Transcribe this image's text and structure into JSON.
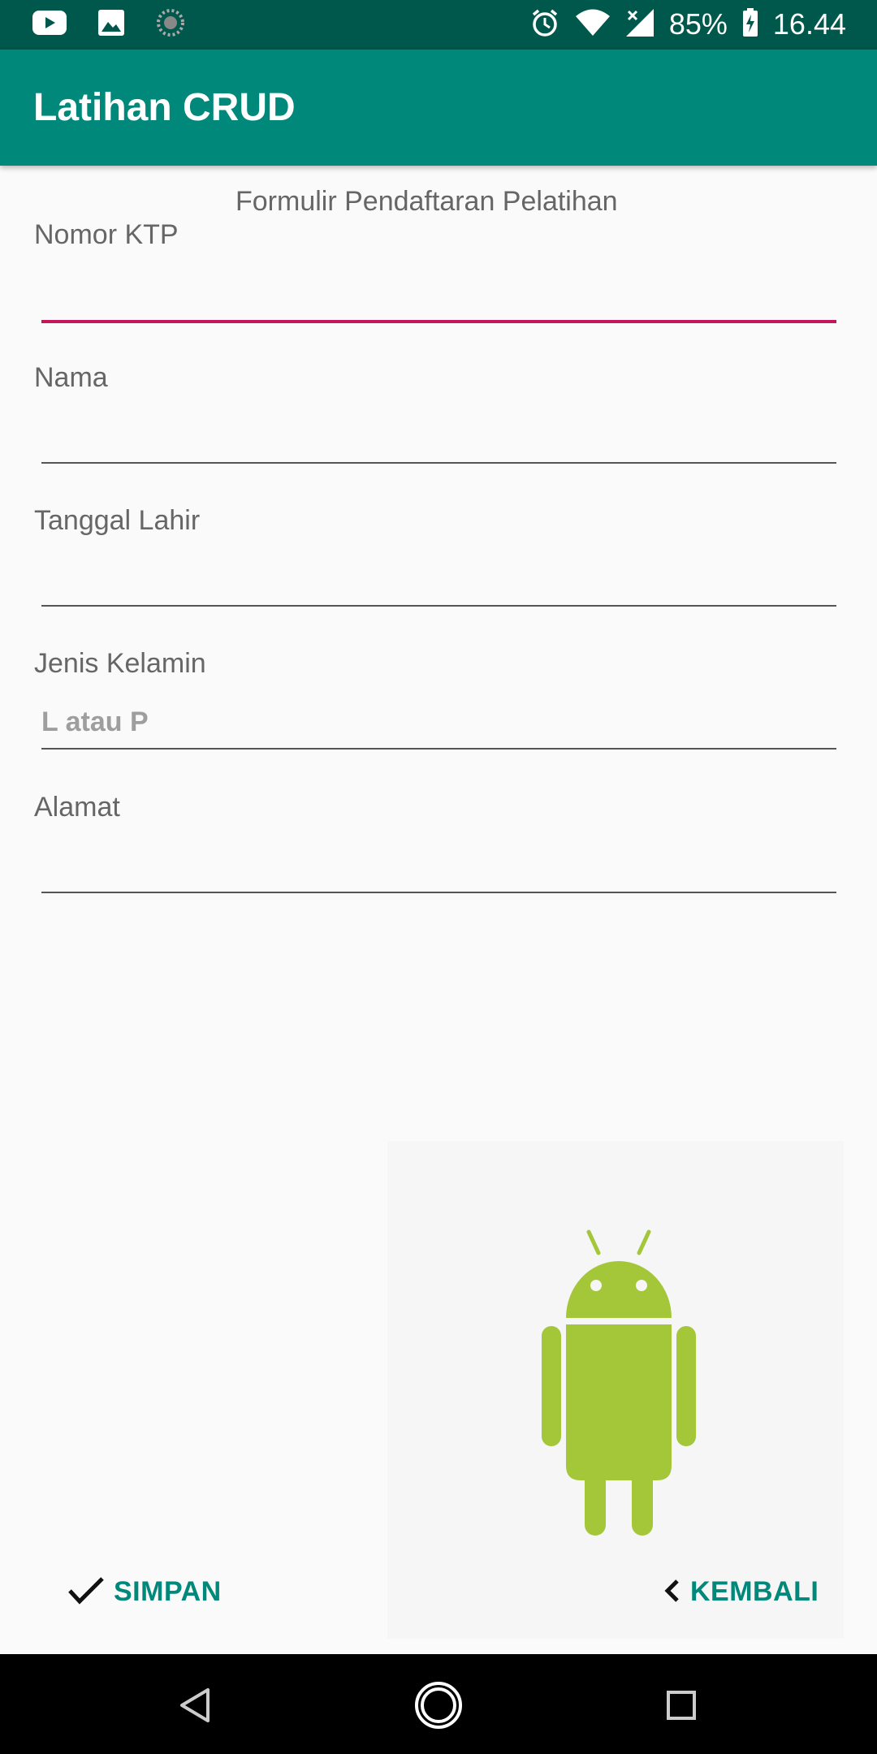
{
  "status_bar": {
    "icons_left": [
      "youtube-icon",
      "image-icon",
      "loading-icon"
    ],
    "icons_right": [
      "alarm-icon",
      "wifi-icon",
      "signal-icon"
    ],
    "battery_percent": "85%",
    "time": "16.44"
  },
  "app_bar": {
    "title": "Latihan CRUD"
  },
  "form": {
    "heading": "Formulir Pendaftaran Pelatihan",
    "fields": [
      {
        "label": "Nomor KTP",
        "value": "",
        "placeholder": ""
      },
      {
        "label": "Nama",
        "value": "",
        "placeholder": ""
      },
      {
        "label": "Tanggal Lahir",
        "value": "",
        "placeholder": ""
      },
      {
        "label": "Jenis Kelamin",
        "value": "",
        "placeholder": "L atau P"
      },
      {
        "label": "Alamat",
        "value": "",
        "placeholder": ""
      }
    ]
  },
  "image": {
    "icon": "android-robot-icon"
  },
  "buttons": {
    "simpan": "SIMPAN",
    "kembali": "KEMBALI"
  },
  "colors": {
    "status_bar": "#00574b",
    "primary": "#00897b",
    "accent": "#c2185b",
    "android_green": "#a4c639"
  },
  "nav_bar": {
    "icons": [
      "back-icon",
      "home-icon",
      "recents-icon"
    ]
  }
}
